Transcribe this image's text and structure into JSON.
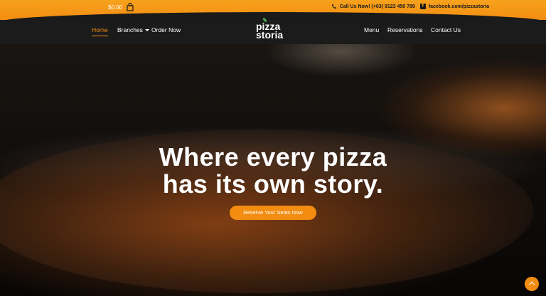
{
  "topbar": {
    "cart_amount": "$0.00",
    "phone_text": "Call Us Now! (+63) 9123 456 789",
    "facebook_text": "facebook.com/pizzastoria"
  },
  "nav": {
    "left": [
      {
        "label": "Home",
        "active": true
      },
      {
        "label": "Branches",
        "has_dropdown": true
      },
      {
        "label": "Order Now"
      }
    ],
    "right": [
      {
        "label": "Menu"
      },
      {
        "label": "Reservations"
      },
      {
        "label": "Contact Us"
      }
    ],
    "logo_line1": "pizza",
    "logo_line2": "storia"
  },
  "hero": {
    "headline_line1": "Where every pizza",
    "headline_line2": "has its own story.",
    "cta_label": "Reserve Your Seats Now"
  },
  "colors": {
    "accent": "#f28d12",
    "nav_bg": "#1b1b1b"
  }
}
